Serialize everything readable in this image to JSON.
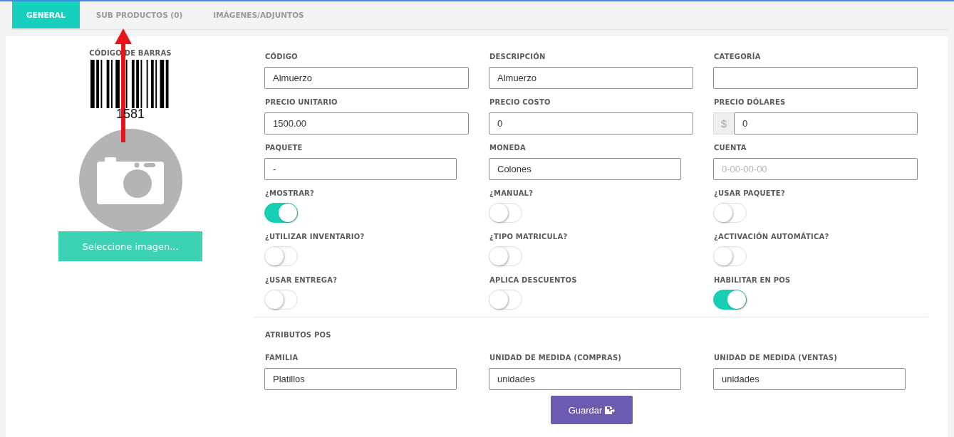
{
  "tabs": [
    {
      "label": "GENERAL",
      "selected": true
    },
    {
      "label": "SUB PRODUCTOS (0)",
      "selected": false
    },
    {
      "label": "IMÁGENES/ADJUNTOS",
      "selected": false
    }
  ],
  "barcode": {
    "label": "CÓDIGO DE BARRAS",
    "number": "1581"
  },
  "select_image_button": "Seleccione imagen...",
  "fields": [
    {
      "kind": "text",
      "label": "CÓDIGO",
      "value": "Almuerzo"
    },
    {
      "kind": "text",
      "label": "DESCRIPCIÓN",
      "value": "Almuerzo"
    },
    {
      "kind": "text",
      "label": "CATEGORÍA"
    },
    {
      "kind": "text",
      "label": "PRECIO UNITARIO",
      "value": "1500.00"
    },
    {
      "kind": "text",
      "label": "PRECIO COSTO",
      "value": "0"
    },
    {
      "kind": "prefixed",
      "label": "PRECIO DÓLARES",
      "prefix": "$",
      "value": "0"
    },
    {
      "kind": "text",
      "label": "PAQUETE",
      "value": "-"
    },
    {
      "kind": "text",
      "label": "MONEDA",
      "value": "Colones"
    },
    {
      "kind": "text",
      "label": "CUENTA",
      "placeholder": "0-00-00-00"
    }
  ],
  "switches": [
    {
      "label": "¿MOSTRAR?",
      "on": true
    },
    {
      "label": "¿MANUAL?",
      "on": false
    },
    {
      "label": "¿USAR PAQUETE?",
      "on": false
    },
    {
      "label": "¿UTILIZAR INVENTARIO?",
      "on": false
    },
    {
      "label": "¿TIPO MATRICULA?",
      "on": false
    },
    {
      "label": "¿ACTIVACIÓN AUTOMÁTICA?",
      "on": false
    },
    {
      "label": "¿USAR ENTREGA?",
      "on": false
    },
    {
      "label": "APLICA DESCUENTOS",
      "on": false
    },
    {
      "label": "HABILITAR EN POS",
      "on": true
    }
  ],
  "pos_section": {
    "title": "ATRIBUTOS POS",
    "fields": [
      {
        "kind": "text",
        "label": "FAMILIA",
        "value": "Platillos"
      },
      {
        "kind": "text",
        "label": "UNIDAD DE MEDIDA (COMPRAS)",
        "value": "unidades"
      },
      {
        "kind": "text",
        "label": "UNIDAD DE MEDIDA (VENTAS)",
        "value": "unidades"
      }
    ]
  },
  "save_button": "Guardar"
}
